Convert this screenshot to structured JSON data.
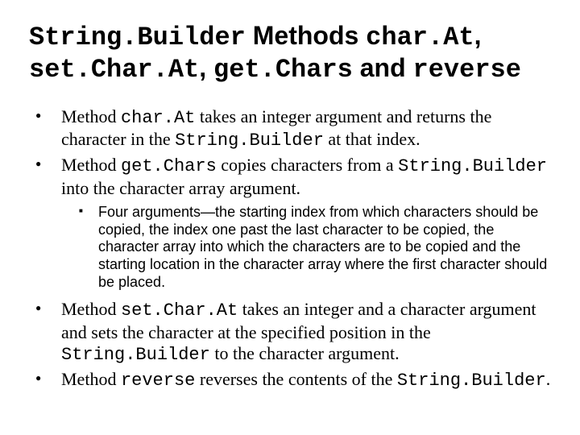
{
  "title": {
    "t1": "String.Builder",
    "t2": " Methods ",
    "t3": "char.At",
    "t4": ", ",
    "t5": "set.Char.At",
    "t6": ", ",
    "t7": "get.Chars",
    "t8": " and ",
    "t9": "reverse"
  },
  "bullets": {
    "b1": {
      "a": "Method ",
      "b": "char.At",
      "c": " takes an integer argument and returns the character in the ",
      "d": "String.Builder",
      "e": " at that index."
    },
    "b2": {
      "a": "Method ",
      "b": "get.Chars",
      "c": " copies characters from a ",
      "d": "String.Builder",
      "e": " into the character array argument."
    },
    "b2sub": {
      "a": "Four arguments—the starting index from which characters should be copied, the index one past the last character to be copied, the character array into which the characters are to be copied and the starting location in the character array where the first character should be placed."
    },
    "b3": {
      "a": "Method ",
      "b": "set.Char.At",
      "c": " takes an integer and a character argument and sets the character at the specified position in the ",
      "d": "String.Builder",
      "e": " to the character argument."
    },
    "b4": {
      "a": "Method ",
      "b": "reverse",
      "c": " reverses the contents of the ",
      "d": "String.Builder",
      "e": "."
    }
  }
}
